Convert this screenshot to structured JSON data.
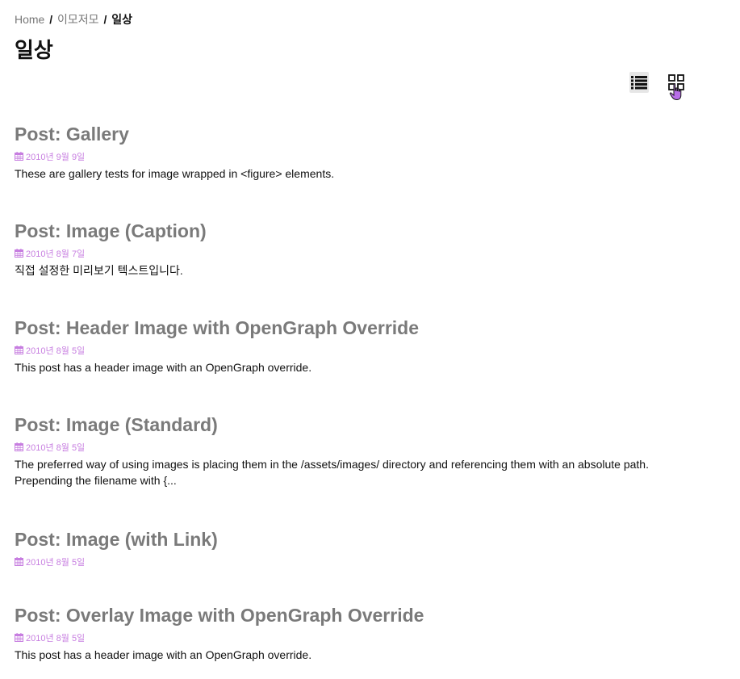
{
  "breadcrumb": {
    "home": "Home",
    "separator": "/",
    "category": "이모저모",
    "current": "일상"
  },
  "page_title": "일상",
  "view_toggle": {
    "list_icon": "list-icon",
    "grid_icon": "grid-icon",
    "active": "list"
  },
  "colors": {
    "title": "#7a7a7a",
    "date": "#c77ee0",
    "text": "#111111",
    "cursor": "#b86ee8"
  },
  "posts": [
    {
      "title": "Post: Gallery",
      "date": "2010년 9월 9일",
      "excerpt": "These are gallery tests for image wrapped in <figure> elements."
    },
    {
      "title": "Post: Image (Caption)",
      "date": "2010년 8월 7일",
      "excerpt": "직접 설정한 미리보기 텍스트입니다."
    },
    {
      "title": "Post: Header Image with OpenGraph Override",
      "date": "2010년 8월 5일",
      "excerpt": "This post has a header image with an OpenGraph override."
    },
    {
      "title": "Post: Image (Standard)",
      "date": "2010년 8월 5일",
      "excerpt": "The preferred way of using images is placing them in the /assets/images/ directory and referencing them with an absolute path. Prepending the filename with {..."
    },
    {
      "title": "Post: Image (with Link)",
      "date": "2010년 8월 5일",
      "excerpt": ""
    },
    {
      "title": "Post: Overlay Image with OpenGraph Override",
      "date": "2010년 8월 5일",
      "excerpt": "This post has a header image with an OpenGraph override."
    }
  ]
}
